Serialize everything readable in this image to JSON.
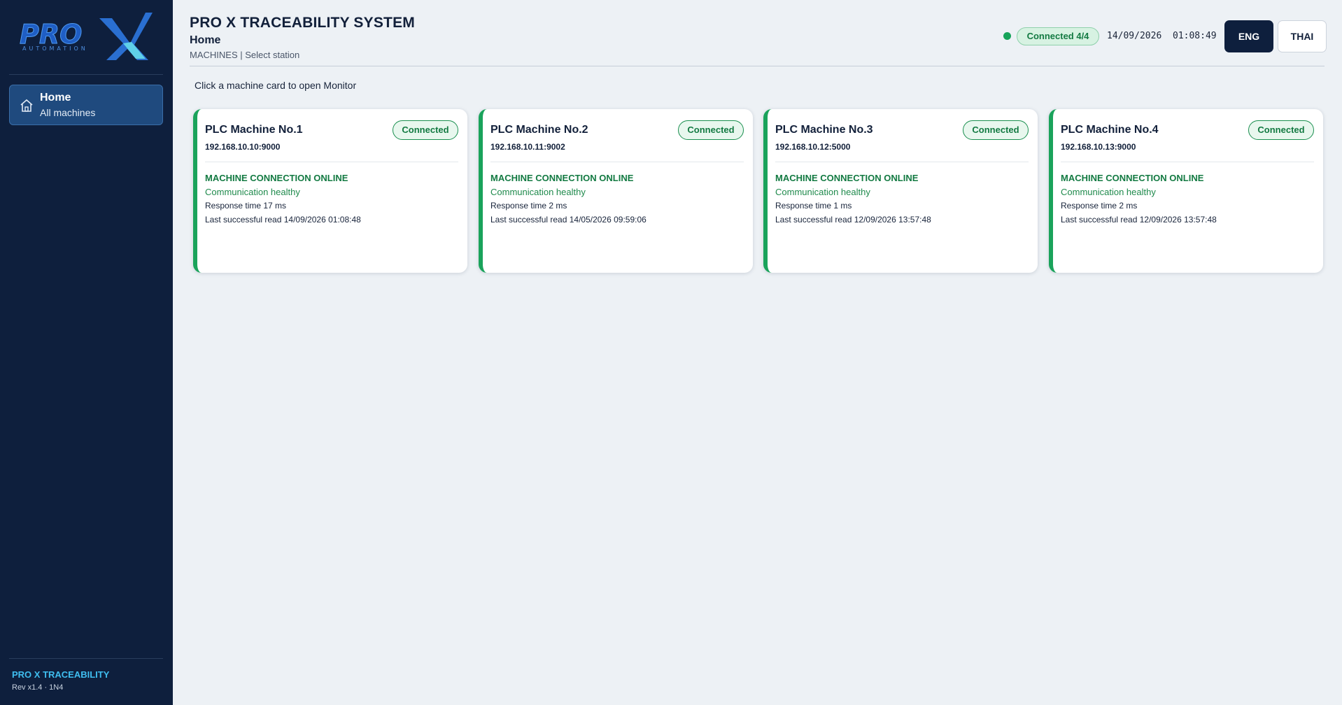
{
  "brand": {
    "logo_text": "PRO",
    "logo_sub": "AUTOMATION",
    "footer_title": "PRO X TRACEABILITY",
    "footer_rev": "Rev x1.4 · 1N4"
  },
  "sidebar": {
    "items": [
      {
        "label": "Home",
        "sublabel": "All machines",
        "icon": "home-icon",
        "active": true
      }
    ]
  },
  "header": {
    "app_title": "PRO X TRACEABILITY SYSTEM",
    "page_title": "Home",
    "breadcrumb": "MACHINES | Select station",
    "connection_status": "Connected 4/4",
    "date": "14/09/2026",
    "time": "01:08:49",
    "lang_eng": "ENG",
    "lang_thai": "THAI"
  },
  "main": {
    "hint": "Click a machine card to open Monitor"
  },
  "machines": [
    {
      "name": "PLC Machine No.1",
      "address": "192.168.10.10:9000",
      "badge": "Connected",
      "status": "MACHINE CONNECTION ONLINE",
      "health": "Communication healthy",
      "response": "Response time 17 ms",
      "last_read": "Last successful read 14/09/2026 01:08:48"
    },
    {
      "name": "PLC Machine No.2",
      "address": "192.168.10.11:9002",
      "badge": "Connected",
      "status": "MACHINE CONNECTION ONLINE",
      "health": "Communication healthy",
      "response": "Response time 2 ms",
      "last_read": "Last successful read 14/05/2026 09:59:06"
    },
    {
      "name": "PLC Machine No.3",
      "address": "192.168.10.12:5000",
      "badge": "Connected",
      "status": "MACHINE CONNECTION ONLINE",
      "health": "Communication healthy",
      "response": "Response time 1 ms",
      "last_read": "Last successful read 12/09/2026 13:57:48"
    },
    {
      "name": "PLC Machine No.4",
      "address": "192.168.10.13:9000",
      "badge": "Connected",
      "status": "MACHINE CONNECTION ONLINE",
      "health": "Communication healthy",
      "response": "Response time 2 ms",
      "last_read": "Last successful read 12/09/2026 13:57:48"
    }
  ],
  "colors": {
    "sidebar_bg": "#0e1f3d",
    "accent_blue": "#1f4a7e",
    "online_green": "#1aa35b",
    "page_bg": "#edf1f5"
  }
}
